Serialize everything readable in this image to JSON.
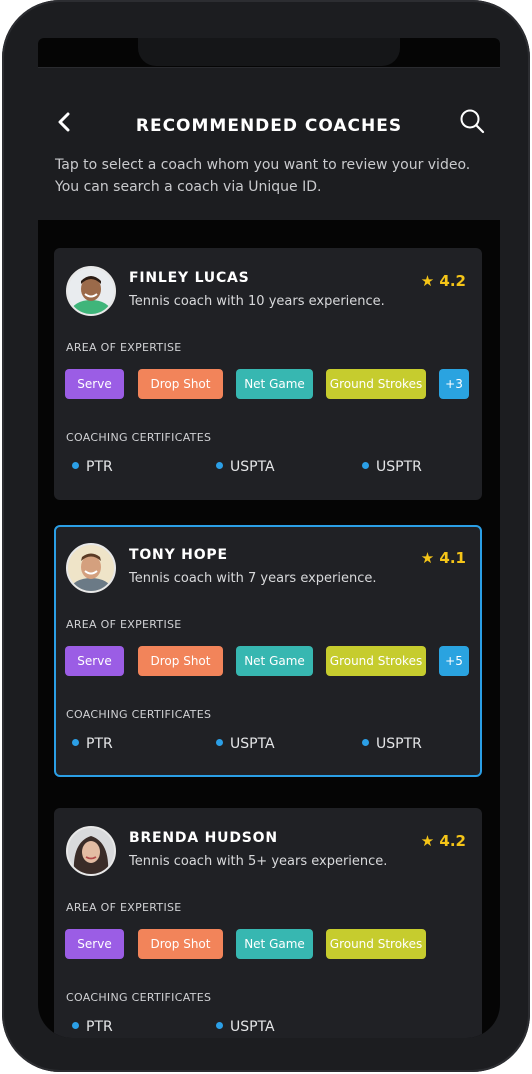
{
  "header": {
    "title": "RECOMMENDED COACHES",
    "subtitle": "Tap to select a coach whom you want to review your video. You can search a coach via Unique ID."
  },
  "labels": {
    "expertise": "AREA OF EXPERTISE",
    "certificates": "COACHING CERTIFICATES"
  },
  "coaches": [
    {
      "name": "FINLEY LUCAS",
      "experience": "Tennis coach with 10 years experience.",
      "rating": "4.2",
      "selected": false,
      "expertise": [
        "Serve",
        "Drop Shot",
        "Net Game",
        "Ground Strokes"
      ],
      "more": "+3",
      "certificates": [
        "PTR",
        "USPTA",
        "USPTR"
      ]
    },
    {
      "name": "TONY HOPE",
      "experience": "Tennis coach with 7 years experience.",
      "rating": "4.1",
      "selected": true,
      "expertise": [
        "Serve",
        "Drop Shot",
        "Net Game",
        "Ground Strokes"
      ],
      "more": "+5",
      "certificates": [
        "PTR",
        "USPTA",
        "USPTR"
      ]
    },
    {
      "name": "BRENDA HUDSON",
      "experience": "Tennis coach with 5+ years experience.",
      "rating": "4.2",
      "selected": false,
      "expertise": [
        "Serve",
        "Drop Shot",
        "Net Game",
        "Ground Strokes"
      ],
      "more": "",
      "certificates": [
        "PTR",
        "USPTA"
      ]
    }
  ],
  "colors": {
    "serve": "#9b5de5",
    "drop_shot": "#f2845a",
    "net_game": "#37b7b1",
    "ground_strokes": "#c6cc2e",
    "more": "#2aa3e0",
    "accent": "#2b9fe6",
    "star": "#f5c518"
  },
  "icons": {
    "back": "chevron-left-icon",
    "search": "search-icon",
    "rating": "star-icon"
  }
}
